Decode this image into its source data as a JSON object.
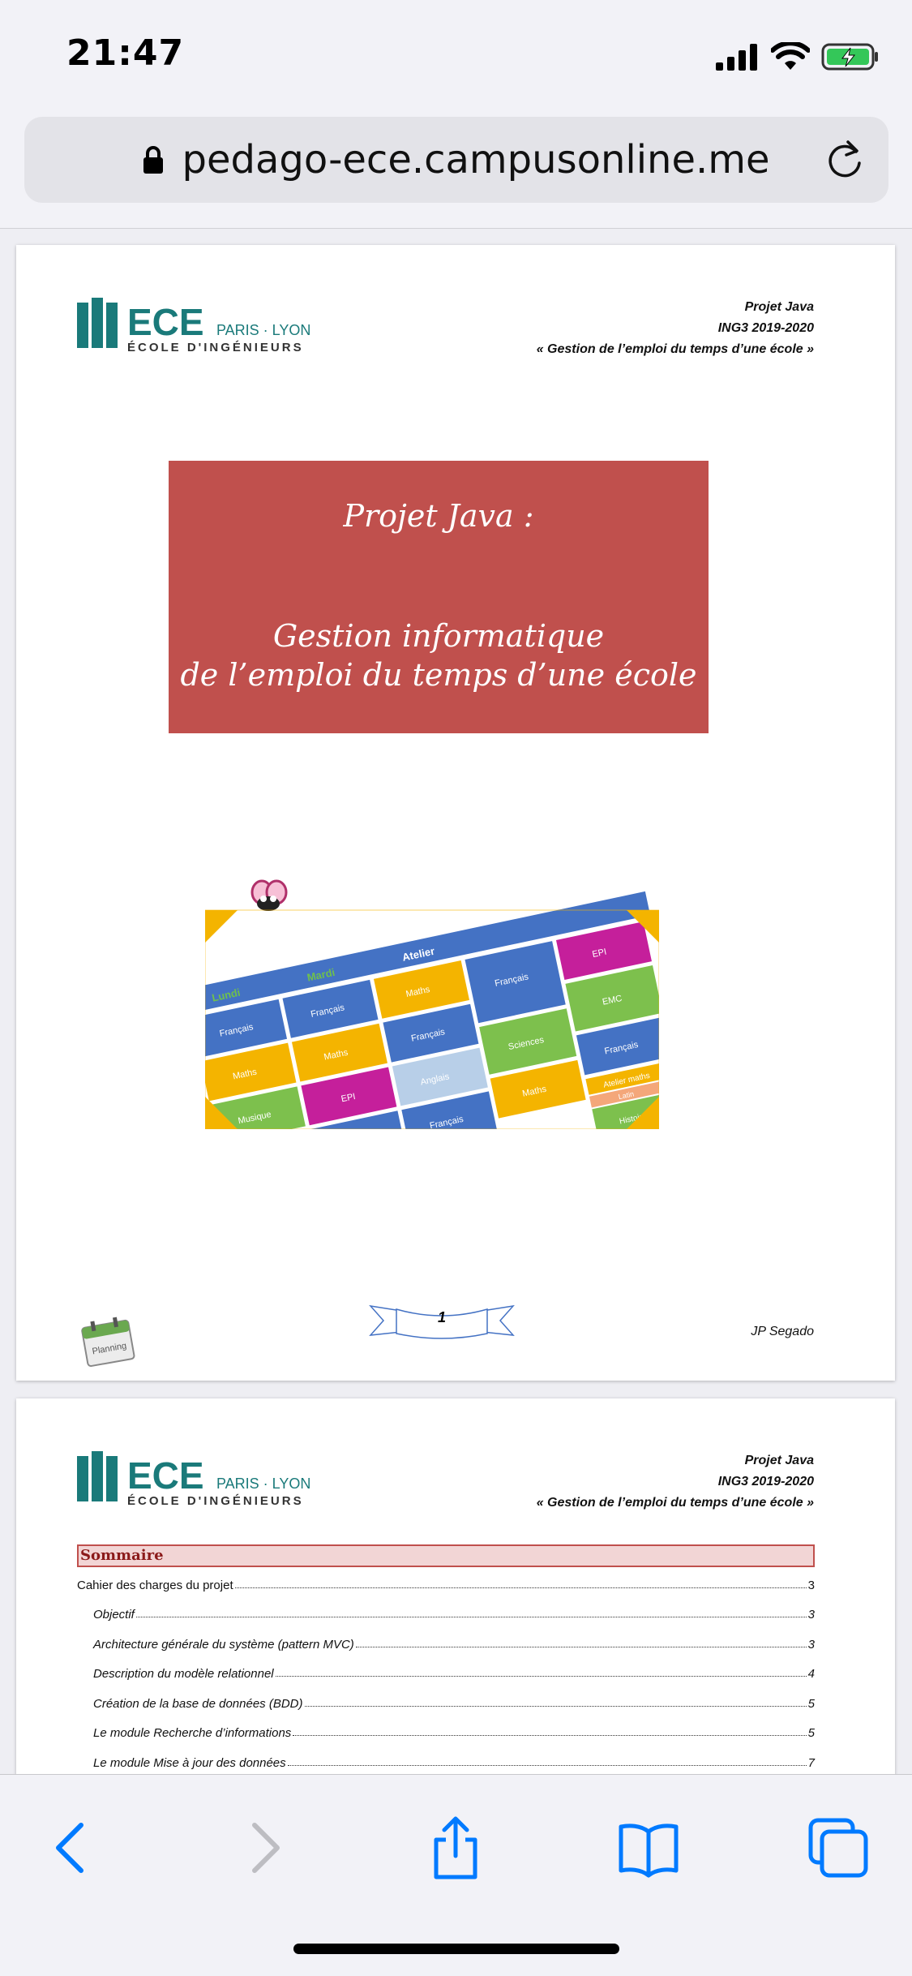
{
  "status": {
    "time": "21:47"
  },
  "browser": {
    "url": "pedago-ece.campusonline.me"
  },
  "doc": {
    "header": {
      "l1": "Projet Java",
      "l2": "ING3 2019-2020",
      "l3": "« Gestion de l’emploi du temps d’une école »"
    },
    "logo": {
      "brand": "ECE",
      "cities": "PARIS · LYON",
      "school": "ÉCOLE D'INGÉNIEURS"
    },
    "title": {
      "line1": "Projet Java :",
      "line2": "Gestion informatique",
      "line3": "de l’emploi du temps d’une école"
    },
    "page_number": "1",
    "author": "JP Segado",
    "calendar_label": "Planning",
    "timetable": {
      "days": [
        "Lundi",
        "Mardi",
        "Atelier"
      ],
      "cells": [
        "Français",
        "Maths",
        "Anglais",
        "Musique",
        "EPI",
        "Sciences",
        "EMC",
        "Histoire",
        "Latin",
        "Atelier maths"
      ]
    },
    "toc": {
      "title": "Sommaire",
      "items": [
        {
          "label": "Cahier des charges du projet",
          "page": "3",
          "sub": false
        },
        {
          "label": "Objectif",
          "page": "3",
          "sub": true
        },
        {
          "label": "Architecture générale du système (pattern MVC)",
          "page": "3",
          "sub": true
        },
        {
          "label": "Description du modèle relationnel",
          "page": "4",
          "sub": true
        },
        {
          "label": "Création de la base de données (BDD)",
          "page": "5",
          "sub": true
        },
        {
          "label": "Le module Recherche d’informations",
          "page": "5",
          "sub": true
        },
        {
          "label": "Le module Mise à jour des données",
          "page": "7",
          "sub": true
        }
      ]
    }
  },
  "colors": {
    "accent": "#c0504d",
    "teal": "#1a7a7a",
    "ios_blue": "#007aff"
  }
}
